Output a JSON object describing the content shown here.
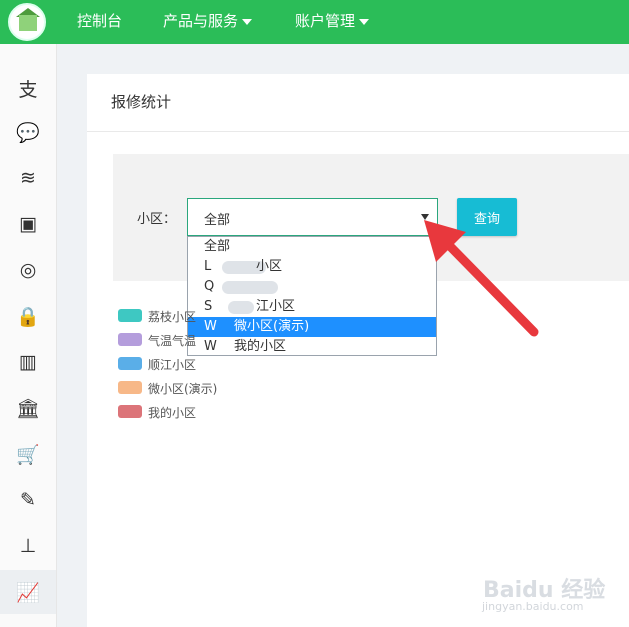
{
  "topnav": {
    "items": [
      {
        "label": "控制台",
        "dropdown": false
      },
      {
        "label": "产品与服务",
        "dropdown": true
      },
      {
        "label": "账户管理",
        "dropdown": true
      }
    ]
  },
  "sidebar": {
    "icons": [
      "alipay-icon",
      "wechat-icon",
      "database-icon",
      "money-icon",
      "lifebuoy-icon",
      "lock-icon",
      "bar-chart-icon",
      "bank-icon",
      "cart-icon",
      "magic-wand-icon",
      "sitemap-icon",
      "line-chart-icon"
    ],
    "glyphs": [
      "支",
      "💬",
      "≋",
      "▣",
      "◎",
      "🔒",
      "▥",
      "🏛",
      "🛒",
      "✎",
      "⊥",
      "📈"
    ],
    "active_index": 11
  },
  "panel": {
    "title": "报修统计",
    "filter_label": "小区：",
    "select_value": "全部",
    "query_label": "查询"
  },
  "dropdown": {
    "options": [
      {
        "code": "全部",
        "name": "",
        "blurred": false,
        "selected": false
      },
      {
        "code": "L",
        "name": "小区",
        "blurred": true,
        "selected": false
      },
      {
        "code": "Q",
        "name": "",
        "blurred": true,
        "selected": false
      },
      {
        "code": "S",
        "name": "江小区",
        "blurred": true,
        "selected": false
      },
      {
        "code": "W",
        "name": "微小区(演示)",
        "blurred": false,
        "selected": true
      },
      {
        "code": "W",
        "name": "我的小区",
        "blurred": false,
        "selected": false
      }
    ]
  },
  "legend": [
    {
      "label": "荔枝小区",
      "color": "#3ec8c2"
    },
    {
      "label": "气温气温",
      "color": "#b49ddc"
    },
    {
      "label": "顺江小区",
      "color": "#5aaee8"
    },
    {
      "label": "微小区(演示)",
      "color": "#f7b888"
    },
    {
      "label": "我的小区",
      "color": "#dc7479"
    }
  ],
  "watermark": {
    "logo": "Baidu 经验",
    "site": "jingyan.baidu.com"
  },
  "colors": {
    "topbar": "#2bbd58",
    "query": "#17bcd4",
    "selected": "#1e90ff",
    "annotation": "#e8383d"
  }
}
